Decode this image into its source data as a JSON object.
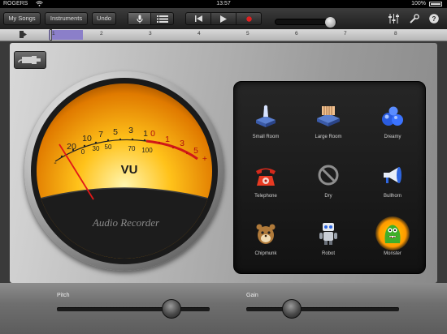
{
  "status_bar": {
    "carrier": "ROGERS",
    "time": "13:57",
    "battery": "100%"
  },
  "toolbar": {
    "my_songs": "My Songs",
    "instruments": "Instruments",
    "undo": "Undo",
    "master_volume": 0.85
  },
  "ruler": {
    "bars": [
      "1",
      "2",
      "3",
      "4",
      "5",
      "6",
      "7",
      "8"
    ]
  },
  "vu_meter": {
    "upper_scale": [
      "-",
      "20",
      "10",
      "7",
      "5",
      "3",
      "1",
      "0",
      "1",
      "3",
      "5",
      "+"
    ],
    "lower_scale": [
      "0",
      "30",
      "50",
      "70",
      "100"
    ],
    "unit_label": "VU",
    "brand": "Audio Recorder"
  },
  "effects": [
    {
      "label": "Small Room",
      "icon": "small-room-icon"
    },
    {
      "label": "Large Room",
      "icon": "large-room-icon"
    },
    {
      "label": "Dreamy",
      "icon": "dreamy-icon"
    },
    {
      "label": "Telephone",
      "icon": "telephone-icon"
    },
    {
      "label": "Dry",
      "icon": "dry-icon"
    },
    {
      "label": "Bullhorn",
      "icon": "bullhorn-icon"
    },
    {
      "label": "Chipmunk",
      "icon": "chipmunk-icon"
    },
    {
      "label": "Robot",
      "icon": "robot-icon"
    },
    {
      "label": "Monster",
      "icon": "monster-icon",
      "selected": true
    }
  ],
  "pitch": {
    "label": "Pitch",
    "value": 0.75
  },
  "gain": {
    "label": "Gain",
    "value": 0.3
  },
  "colors": {
    "accent": "#ff9a00",
    "record": "#e02020",
    "region": "#8b7fc9"
  }
}
